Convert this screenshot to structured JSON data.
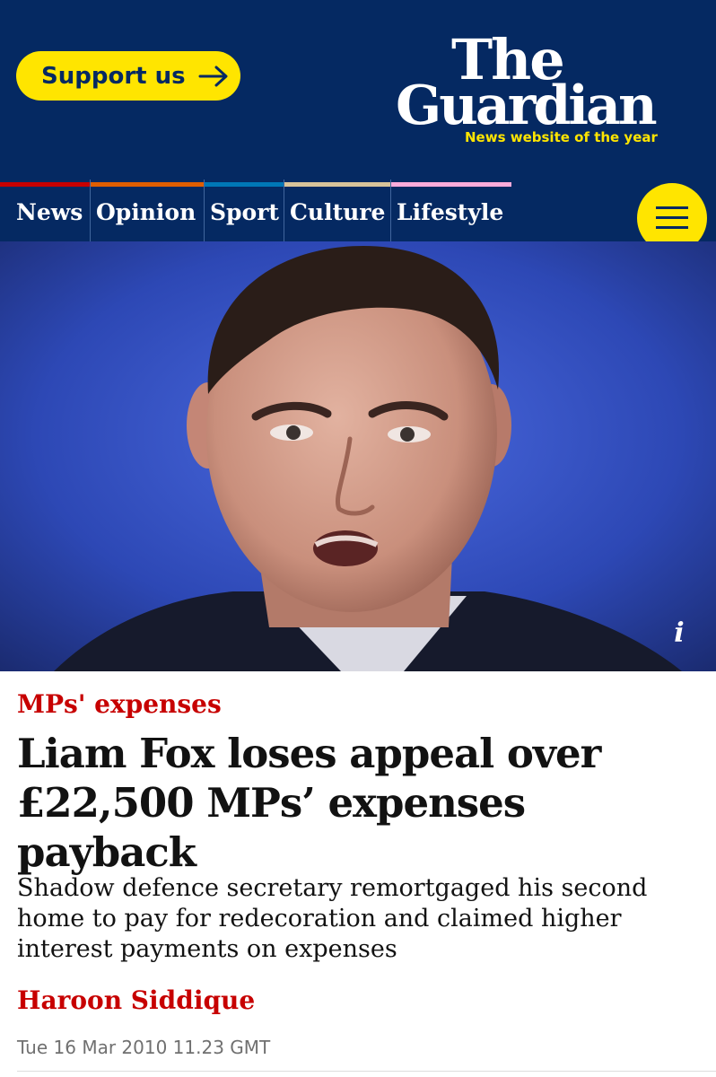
{
  "header": {
    "support_label": "Support us",
    "logo_line1": "The",
    "logo_line2": "Guardian",
    "tagline": "News website of the year"
  },
  "nav": {
    "items": [
      {
        "label": "News",
        "color": "#c70000"
      },
      {
        "label": "Opinion",
        "color": "#e05e00"
      },
      {
        "label": "Sport",
        "color": "#0077b6"
      },
      {
        "label": "Culture",
        "color": "#a1845c"
      },
      {
        "label": "Lifestyle",
        "color": "#bb3b80"
      }
    ]
  },
  "hero": {
    "info_label": "i"
  },
  "article": {
    "kicker": "MPs' expenses",
    "headline": "Liam Fox loses appeal over £22,500 MPs’ expenses payback",
    "standfirst": "Shadow defence secretary remortgaged his second home to pay for redecoration and claimed higher interest payments on expenses",
    "byline": "Haroon Siddique",
    "dateline": "Tue 16 Mar 2010 11.23 GMT"
  },
  "colors": {
    "brand_blue": "#052962",
    "brand_yellow": "#ffe500",
    "kicker_red": "#c70000"
  }
}
